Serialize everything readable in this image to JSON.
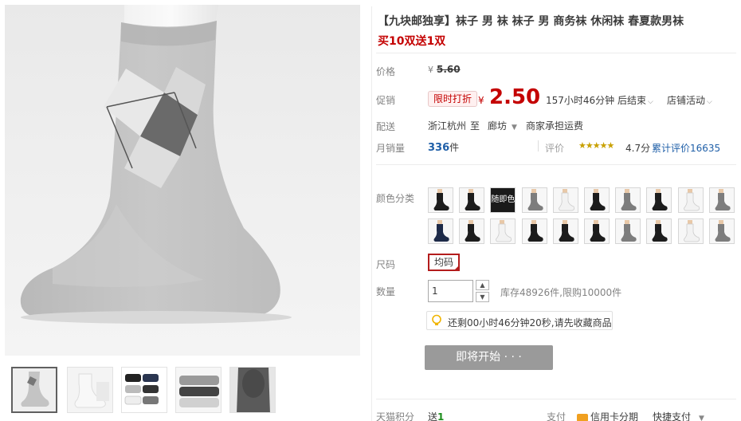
{
  "product": {
    "title": "【九块邮独享】袜子 男 袜 袜子 男 商务袜 休闲袜 春夏款男袜",
    "subtitle": "买10双送1双"
  },
  "price": {
    "label": "价格",
    "currency": "¥",
    "original": "5.60"
  },
  "promo": {
    "label": "促销",
    "tag": "限时打折",
    "currency": "¥",
    "price": "2.50",
    "countdown": "157小时46分钟 后结束",
    "store_activity": "店铺活动"
  },
  "shipping": {
    "label": "配送",
    "from": "浙江杭州",
    "to_word": "至",
    "dest": "廊坊",
    "fee": "商家承担运费"
  },
  "sales": {
    "label": "月销量",
    "count": "336",
    "unit": "件",
    "rating_label": "评价",
    "stars": "★★★★★",
    "rating": "4.7分",
    "review_count": "累计评价16635"
  },
  "color": {
    "label": "颜色分类",
    "random_label": "随即色",
    "swatches_row1": [
      "dark",
      "dark",
      "random",
      "gray",
      "white",
      "dark",
      "gray",
      "dark",
      "white",
      "gray"
    ],
    "swatches_row2": [
      "navy",
      "dark",
      "white",
      "dark",
      "dark",
      "dark",
      "gray",
      "dark",
      "white",
      "gray"
    ]
  },
  "size": {
    "label": "尺码",
    "value": "均码"
  },
  "quantity": {
    "label": "数量",
    "value": "1",
    "stock": "库存48926件,限购10000件"
  },
  "tip": {
    "icon": "lightbulb-icon",
    "text": "还剩00小时46分钟20秒,请先收藏商品"
  },
  "buy_button": {
    "label": "即将开始 · · ·"
  },
  "bottom": {
    "points_label": "天猫积分",
    "points_prefix": "送",
    "points_value": "1",
    "pay_label": "支付",
    "credit_installment": "信用卡分期",
    "quick_pay": "快捷支付"
  },
  "colors": {
    "accent_red": "#c40000",
    "link_blue": "#1f5fa8",
    "disabled_gray": "#9a9a9a"
  }
}
